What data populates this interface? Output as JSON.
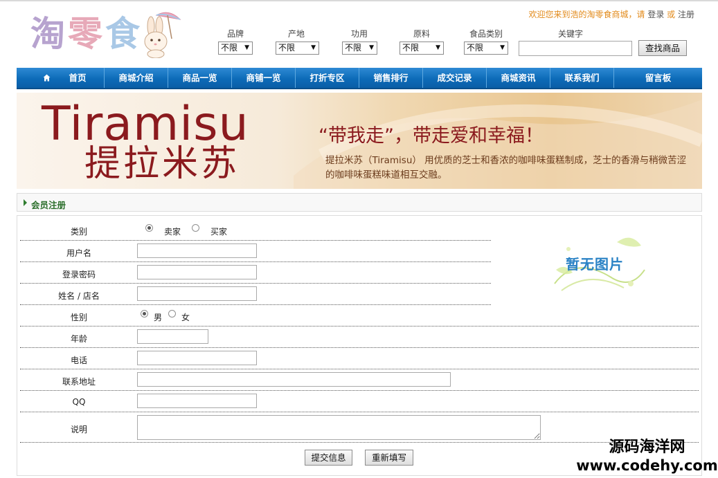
{
  "logo": {
    "chars": [
      "淘",
      "零",
      "食"
    ]
  },
  "welcome": {
    "text": "欢迎您来到浩的淘零食商城，请 ",
    "login": "登录",
    "or": " 或 ",
    "register": "注册"
  },
  "filters": [
    {
      "label": "品牌",
      "value": "不限"
    },
    {
      "label": "产地",
      "value": "不限"
    },
    {
      "label": "功用",
      "value": "不限"
    },
    {
      "label": "原料",
      "value": "不限"
    },
    {
      "label": "食品类别",
      "value": "不限"
    }
  ],
  "keyword": {
    "label": "关键字",
    "value": ""
  },
  "search_button": "查找商品",
  "nav": [
    "首页",
    "商城介绍",
    "商品一览",
    "商铺一览",
    "打折专区",
    "销售排行",
    "成交记录",
    "商城资讯",
    "联系我们",
    "留言板"
  ],
  "banner": {
    "title_en": "Tiramisu",
    "title_cn": "提拉米苏",
    "slogan": "“带我走”，带走爱和幸福！",
    "desc": "提拉米苏（Tiramisu） 用优质的芝士和香浓的咖啡味蛋糕制成，芝士的香滑与稍微苦涩的咖啡味蛋糕味道相互交融。"
  },
  "section": {
    "title": "会员注册"
  },
  "form": {
    "category": {
      "label": "类别",
      "options": [
        "卖家",
        "买家"
      ],
      "selected": "卖家"
    },
    "username": {
      "label": "用户名",
      "value": ""
    },
    "password": {
      "label": "登录密码",
      "value": ""
    },
    "name": {
      "label": "姓名 / 店名",
      "value": ""
    },
    "gender": {
      "label": "性别",
      "options": [
        "男",
        "女"
      ],
      "selected": "男"
    },
    "age": {
      "label": "年龄",
      "value": ""
    },
    "phone": {
      "label": "电话",
      "value": ""
    },
    "address": {
      "label": "联系地址",
      "value": ""
    },
    "qq": {
      "label": "QQ",
      "value": ""
    },
    "note": {
      "label": "说明",
      "value": ""
    },
    "no_image": "暂无图片",
    "submit": "提交信息",
    "reset": "重新填写"
  },
  "watermark": {
    "line1": "源码海洋网",
    "line2": "www.codehy.com"
  },
  "colors": {
    "nav_blue": "#0d6bb8",
    "banner_red": "#8b1a1e",
    "welcome_orange": "#e28a1a",
    "section_green": "#2a6e2a"
  }
}
